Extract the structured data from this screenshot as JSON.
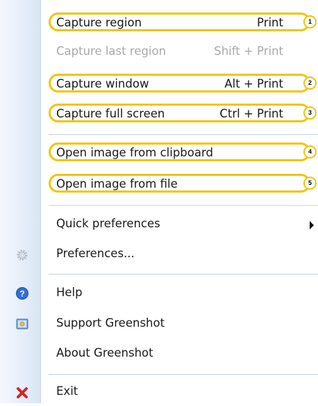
{
  "menu": {
    "items": [
      {
        "label": "Capture region",
        "shortcut": "Print",
        "badge": "1"
      },
      {
        "label": "Capture last region",
        "shortcut": "Shift + Print"
      },
      {
        "label": "Capture window",
        "shortcut": "Alt + Print",
        "badge": "2"
      },
      {
        "label": "Capture full screen",
        "shortcut": "Ctrl + Print",
        "badge": "3"
      },
      {
        "label": "Open image from clipboard",
        "badge": "4"
      },
      {
        "label": "Open image from file",
        "badge": "5"
      },
      {
        "label": "Quick preferences"
      },
      {
        "label": "Preferences...",
        "icon": "gear-icon"
      },
      {
        "label": "Help",
        "icon": "help-icon"
      },
      {
        "label": "Support Greenshot",
        "icon": "support-icon"
      },
      {
        "label": "About Greenshot"
      },
      {
        "label": "Exit",
        "icon": "close-icon"
      }
    ],
    "highlight_color": "#f2c400",
    "disabled_text_color": "#a9a9a9"
  }
}
